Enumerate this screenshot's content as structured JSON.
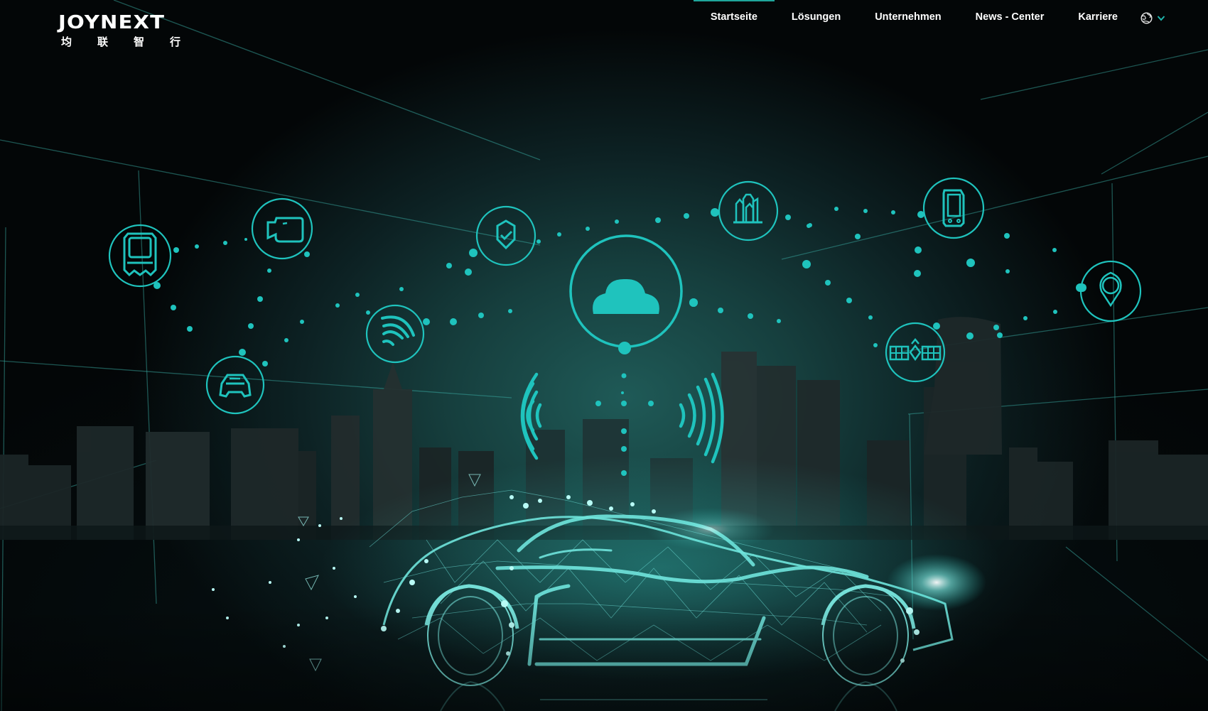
{
  "brand": {
    "name": "JOYNEXT",
    "subtitle_chars": [
      "均",
      "联",
      "智",
      "行"
    ]
  },
  "nav": {
    "items": [
      {
        "label": "Startseite",
        "active": true
      },
      {
        "label": "Lösungen",
        "active": false
      },
      {
        "label": "Unternehmen",
        "active": false
      },
      {
        "label": "News - Center",
        "active": false
      },
      {
        "label": "Karriere",
        "active": false
      }
    ],
    "language_icon": "globe-icon",
    "language_chevron": "chevron-down-icon"
  },
  "hero": {
    "icons": [
      "train-icon",
      "camera-icon",
      "car-front-icon",
      "wifi-signal-icon",
      "shield-check-icon",
      "cloud-icon",
      "city-buildings-icon",
      "smartphone-icon",
      "location-pin-icon",
      "satellite-icon"
    ],
    "illustration": "wireframe-connected-car"
  },
  "colors": {
    "accent": "#1fc3bd",
    "active_indicator": "#1fa59b",
    "background": "#05090b",
    "text": "#ffffff"
  }
}
